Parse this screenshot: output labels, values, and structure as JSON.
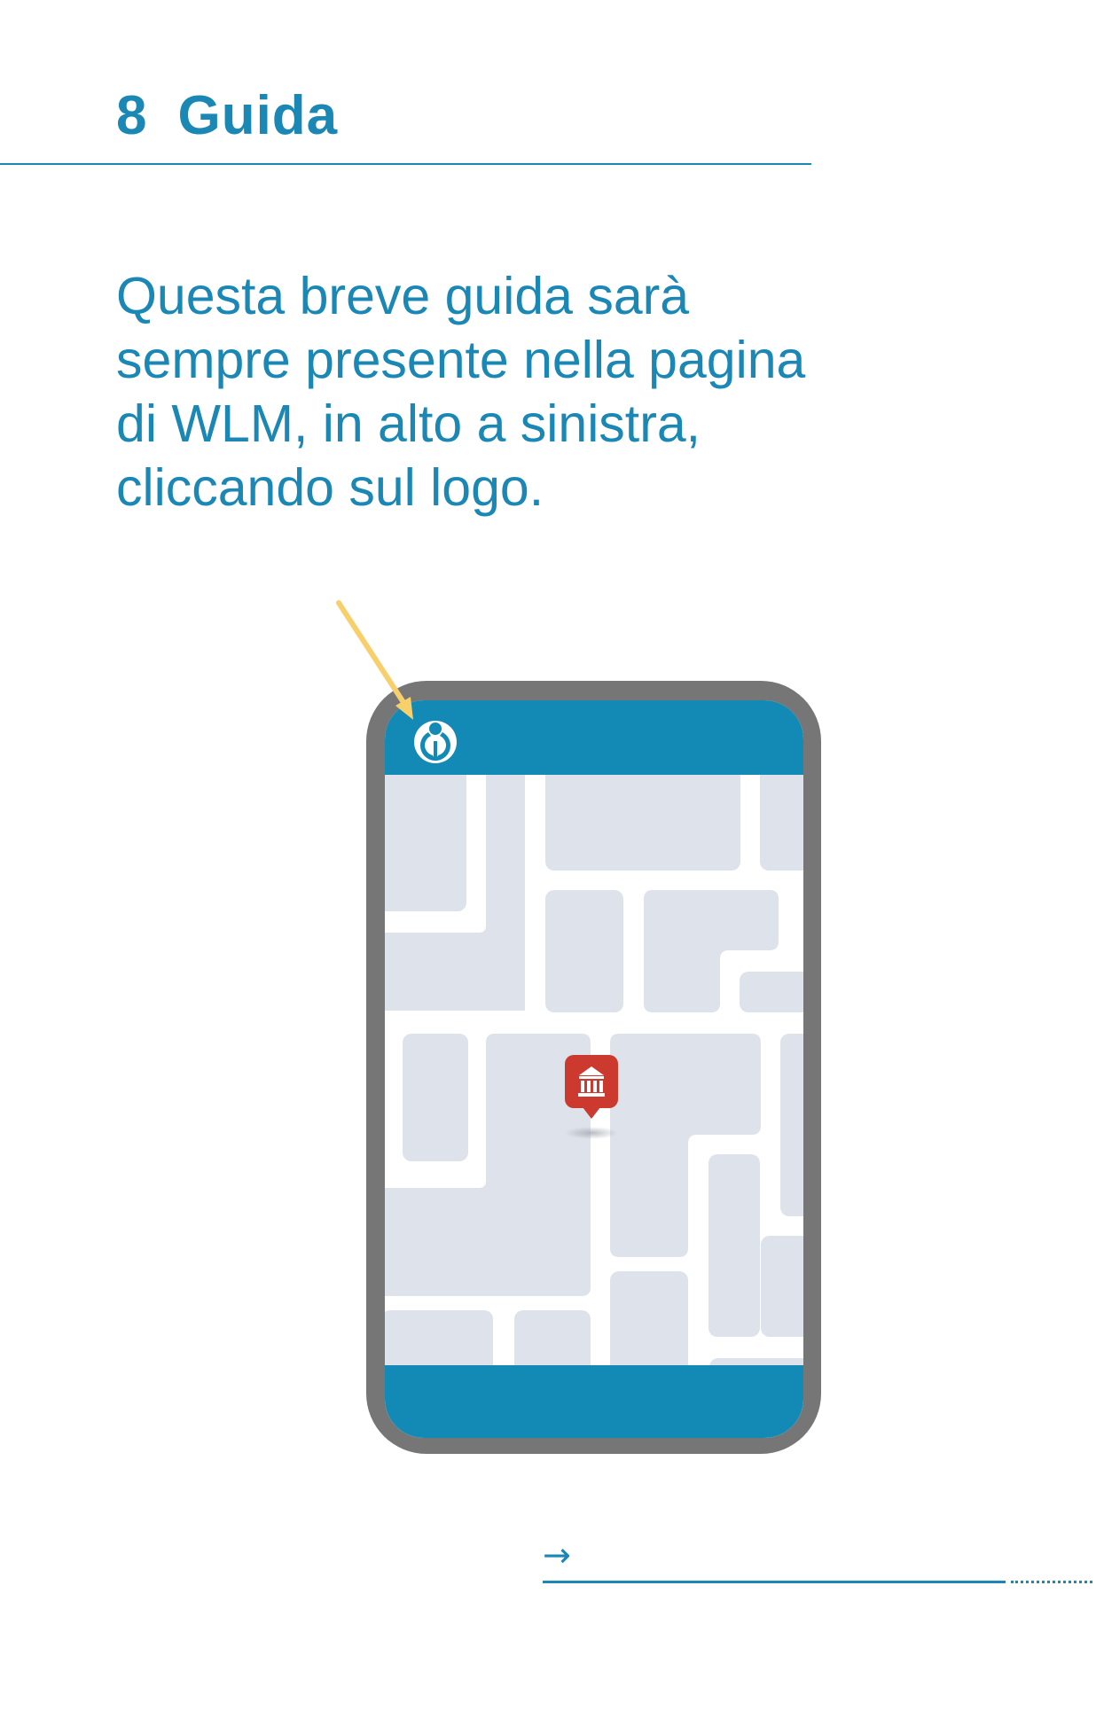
{
  "section": {
    "number": "8",
    "title": "Guida"
  },
  "intro": {
    "lines": [
      "Questa breve guida sarà",
      "sempre presente nella pagina",
      "di WLM, in alto a sinistra,",
      "cliccando sul logo."
    ]
  },
  "illustration": {
    "icons": [
      "wikimedia-logo-icon",
      "museum-map-pin-icon",
      "pointer-arrow-icon"
    ],
    "colors": {
      "phone_frame": "#767676",
      "app_bar": "#138ab5",
      "map_background": "#ffffff",
      "map_blocks": "#dee2ea",
      "pin": "#cc3a2f",
      "pointer_arrow": "#f7cf6b"
    }
  },
  "footer": {
    "next_arrow": "→"
  },
  "colors": {
    "accent": "#1a87b4"
  }
}
